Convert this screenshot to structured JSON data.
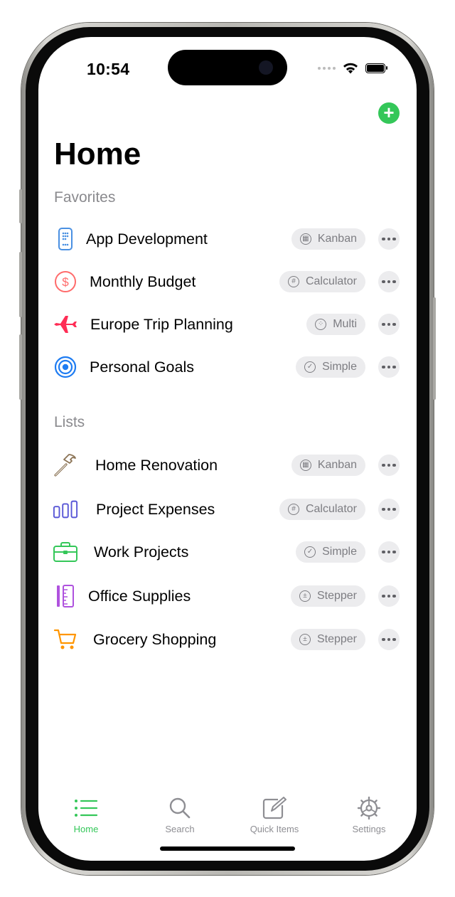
{
  "status_bar": {
    "time": "10:54"
  },
  "header": {
    "title": "Home",
    "add_label": "+"
  },
  "sections": {
    "favorites": "Favorites",
    "lists": "Lists"
  },
  "favorites": [
    {
      "label": "App Development",
      "icon": "phone-icon",
      "icon_color": "#4a90e2",
      "chip": "Kanban",
      "chip_icon": "kanban-icon",
      "chip_glyph": "▦"
    },
    {
      "label": "Monthly Budget",
      "icon": "dollar-icon",
      "icon_color": "#ff6b6b",
      "chip": "Calculator",
      "chip_icon": "hash-icon",
      "chip_glyph": "#"
    },
    {
      "label": "Europe Trip Planning",
      "icon": "airplane-icon",
      "icon_color": "#ff2d55",
      "chip": "Multi",
      "chip_icon": "multi-icon",
      "chip_glyph": "⁘"
    },
    {
      "label": "Personal Goals",
      "icon": "target-icon",
      "icon_color": "#1e7cf2",
      "chip": "Simple",
      "chip_icon": "check-icon",
      "chip_glyph": "✓"
    }
  ],
  "lists": [
    {
      "label": "Home Renovation",
      "icon": "hammer-icon",
      "icon_color": "#8b7355",
      "chip": "Kanban",
      "chip_icon": "kanban-icon",
      "chip_glyph": "▦"
    },
    {
      "label": "Project Expenses",
      "icon": "bar-chart-icon",
      "icon_color": "#5856d6",
      "chip": "Calculator",
      "chip_icon": "hash-icon",
      "chip_glyph": "#"
    },
    {
      "label": "Work Projects",
      "icon": "briefcase-icon",
      "icon_color": "#34c759",
      "chip": "Simple",
      "chip_icon": "check-icon",
      "chip_glyph": "✓"
    },
    {
      "label": "Office Supplies",
      "icon": "ruler-icon",
      "icon_color": "#af52de",
      "chip": "Stepper",
      "chip_icon": "plus-minus-icon",
      "chip_glyph": "±"
    },
    {
      "label": "Grocery Shopping",
      "icon": "cart-icon",
      "icon_color": "#ff9500",
      "chip": "Stepper",
      "chip_icon": "plus-minus-icon",
      "chip_glyph": "±"
    }
  ],
  "tabbar": {
    "home": "Home",
    "search": "Search",
    "quick_items": "Quick Items",
    "settings": "Settings"
  },
  "colors": {
    "accent": "#34c759",
    "chip_bg": "#ececee",
    "section_text": "#8a8a8e"
  }
}
